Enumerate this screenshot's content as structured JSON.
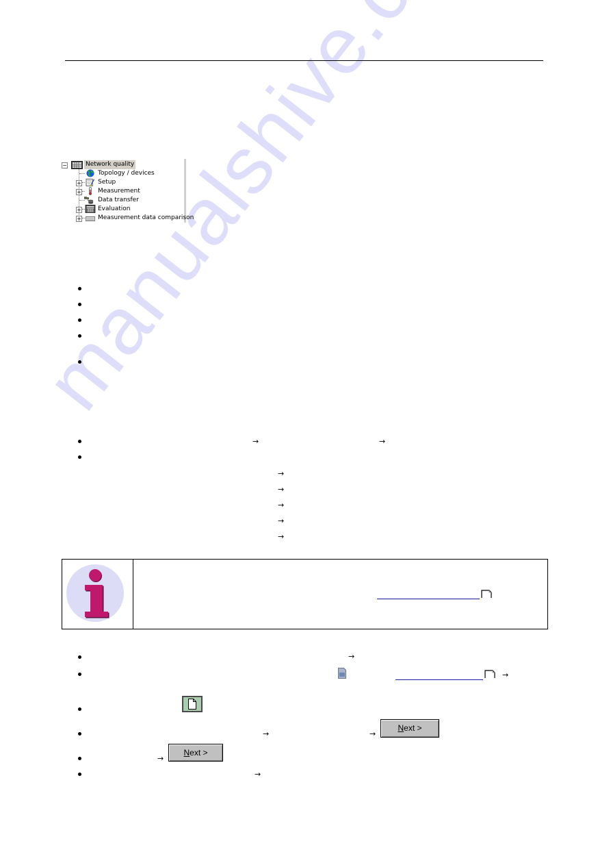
{
  "tree": {
    "root": {
      "label": "Network quality",
      "expanded": true,
      "icon": "grid-icon"
    },
    "items": [
      {
        "label": "Topology / devices",
        "icon": "globe-icon",
        "expandable": false
      },
      {
        "label": "Setup",
        "icon": "notepad-icon",
        "expandable": true
      },
      {
        "label": "Measurement",
        "icon": "thermometer-icon",
        "expandable": true
      },
      {
        "label": "Data transfer",
        "icon": "database-transfer-icon",
        "expandable": false
      },
      {
        "label": "Evaluation",
        "icon": "calculator-icon",
        "expandable": true
      },
      {
        "label": "Measurement data comparison",
        "icon": "drive-icon",
        "expandable": true
      }
    ],
    "collapse_glyph": "−",
    "expand_glyph": "+"
  },
  "arrow_glyph": "→",
  "buttons": {
    "next_1": {
      "mnemonic": "N",
      "rest": "ext >"
    },
    "next_2": {
      "mnemonic": "N",
      "rest": "ext >"
    }
  },
  "info_box": {
    "icon": "info-icon"
  },
  "watermark": "manualshive.com"
}
